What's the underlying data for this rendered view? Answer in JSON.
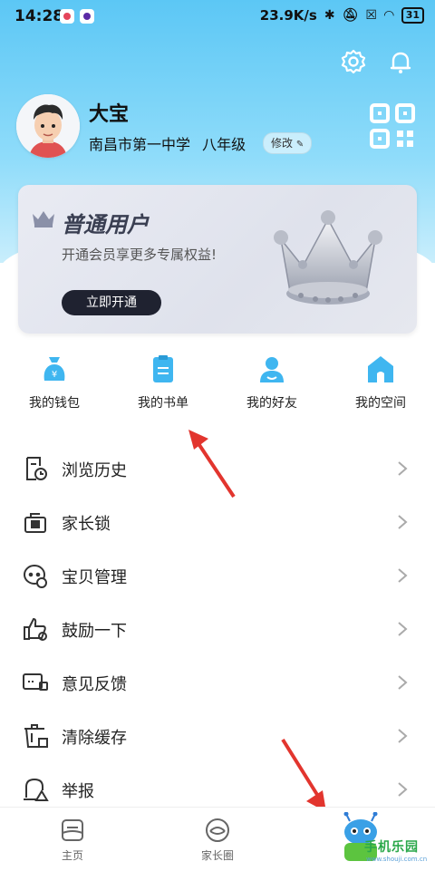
{
  "statusbar": {
    "time": "14:28",
    "speed": "23.9K/s",
    "battery": "31"
  },
  "top_actions": {
    "settings_icon": "gear-icon",
    "notification_icon": "bell-icon"
  },
  "profile": {
    "name": "大宝",
    "school": "南昌市第一中学",
    "grade": "八年级",
    "edit_label": "修改"
  },
  "membership": {
    "title": "普通用户",
    "subtitle": "开通会员享更多专属权益!",
    "cta": "立即开通"
  },
  "quick_actions": [
    {
      "label": "我的钱包",
      "icon": "wallet-icon"
    },
    {
      "label": "我的书单",
      "icon": "booklist-icon"
    },
    {
      "label": "我的好友",
      "icon": "friend-icon"
    },
    {
      "label": "我的空间",
      "icon": "home-icon"
    }
  ],
  "menu": [
    {
      "label": "浏览历史",
      "icon": "history-icon"
    },
    {
      "label": "家长锁",
      "icon": "lock-icon"
    },
    {
      "label": "宝贝管理",
      "icon": "baby-icon"
    },
    {
      "label": "鼓励一下",
      "icon": "thumbs-up-icon"
    },
    {
      "label": "意见反馈",
      "icon": "feedback-icon"
    },
    {
      "label": "清除缓存",
      "icon": "trash-icon"
    },
    {
      "label": "举报",
      "icon": "report-icon"
    }
  ],
  "tabs": [
    {
      "label": "主页",
      "icon": "home-tab-icon"
    },
    {
      "label": "家长圈",
      "icon": "parent-circle-icon"
    },
    {
      "label": "",
      "icon": "mine-tab-icon"
    }
  ],
  "watermark": {
    "text": "手机乐园",
    "url": "www.shouji.com.cn"
  },
  "colors": {
    "hero": "#5cc7f5",
    "accent": "#3fb6f0",
    "dark_button": "#1f2230",
    "arrow": "#e2352e"
  }
}
